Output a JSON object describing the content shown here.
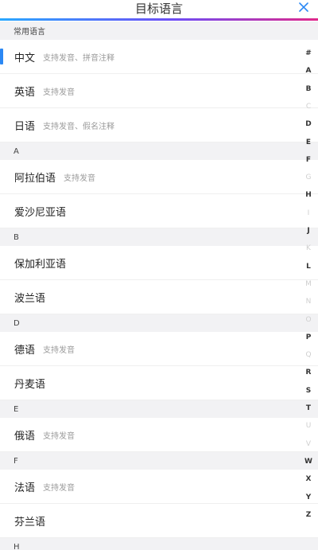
{
  "header": {
    "title": "目标语言",
    "close_icon": "close-icon"
  },
  "colors": {
    "accent": "#2b88f4",
    "gradient_start": "#2aa8ff",
    "gradient_end": "#e0288a"
  },
  "list": {
    "common_header": "常用语言",
    "common": [
      {
        "name": "中文",
        "hint": "支持发音、拼音注释",
        "active": true
      },
      {
        "name": "英语",
        "hint": "支持发音"
      },
      {
        "name": "日语",
        "hint": "支持发音、假名注释"
      }
    ],
    "sections": [
      {
        "letter": "A",
        "items": [
          {
            "name": "阿拉伯语",
            "hint": "支持发音"
          },
          {
            "name": "爱沙尼亚语",
            "hint": ""
          }
        ]
      },
      {
        "letter": "B",
        "items": [
          {
            "name": "保加利亚语",
            "hint": ""
          },
          {
            "name": "波兰语",
            "hint": ""
          }
        ]
      },
      {
        "letter": "D",
        "items": [
          {
            "name": "德语",
            "hint": "支持发音"
          },
          {
            "name": "丹麦语",
            "hint": ""
          }
        ]
      },
      {
        "letter": "E",
        "items": [
          {
            "name": "俄语",
            "hint": "支持发音"
          }
        ]
      },
      {
        "letter": "F",
        "items": [
          {
            "name": "法语",
            "hint": "支持发音"
          },
          {
            "name": "芬兰语",
            "hint": ""
          }
        ]
      },
      {
        "letter": "H",
        "items": []
      }
    ]
  },
  "index": {
    "letters": [
      "#",
      "A",
      "B",
      "C",
      "D",
      "E",
      "F",
      "G",
      "H",
      "I",
      "J",
      "K",
      "L",
      "M",
      "N",
      "O",
      "P",
      "Q",
      "R",
      "S",
      "T",
      "U",
      "V",
      "W",
      "X",
      "Y",
      "Z"
    ],
    "dim": [
      "C",
      "G",
      "I",
      "K",
      "M",
      "N",
      "O",
      "Q",
      "U",
      "V"
    ]
  }
}
